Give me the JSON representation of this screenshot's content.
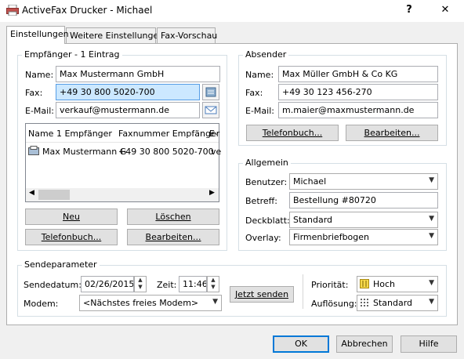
{
  "window": {
    "title": "ActiveFax Drucker - Michael",
    "help": "?",
    "close": "✕"
  },
  "tabs": [
    "Einstellungen",
    "Weitere Einstellungen",
    "Fax-Vorschau"
  ],
  "recipient": {
    "group_label": "Empfänger - 1 Eintrag",
    "name_label": "Name:",
    "name_value": "Max Mustermann GmbH",
    "fax_label": "Fax:",
    "fax_value": "+49 30 800 5020-700",
    "email_label": "E-Mail:",
    "email_value": "verkauf@mustermann.de",
    "columns": [
      "Name 1 Empfänger",
      "Faxnummer Empfänger",
      "E-"
    ],
    "rows": [
      [
        "Max Mustermann G",
        "+49 30 800 5020-700",
        "ve"
      ]
    ],
    "buttons": {
      "new": "Neu",
      "delete": "Löschen",
      "phonebook": "Telefonbuch...",
      "edit": "Bearbeiten..."
    }
  },
  "sender": {
    "group_label": "Absender",
    "name_label": "Name:",
    "name_value": "Max Müller GmbH & Co KG",
    "fax_label": "Fax:",
    "fax_value": "+49 30 123 456-270",
    "email_label": "E-Mail:",
    "email_value": "m.maier@maxmustermann.de",
    "buttons": {
      "phonebook": "Telefonbuch...",
      "edit": "Bearbeiten..."
    }
  },
  "general": {
    "group_label": "Allgemein",
    "user_label": "Benutzer:",
    "user_value": "Michael",
    "subject_label": "Betreff:",
    "subject_value": "Bestellung #80720",
    "cover_label": "Deckblatt:",
    "cover_value": "Standard",
    "overlay_label": "Overlay:",
    "overlay_value": "Firmenbriefbogen"
  },
  "send": {
    "group_label": "Sendeparameter",
    "date_label": "Sendedatum:",
    "date_value": "02/26/2015",
    "time_label": "Zeit:",
    "time_value": "11:46",
    "modem_label": "Modem:",
    "modem_value": "<Nächstes freies Modem>",
    "send_now": "Jetzt senden",
    "priority_label": "Priorität:",
    "priority_value": "Hoch",
    "resolution_label": "Auflösung:",
    "resolution_value": "Standard"
  },
  "footer": {
    "ok": "OK",
    "cancel": "Abbrechen",
    "help": "Hilfe"
  },
  "colors": {
    "accent": "#0078d7",
    "focus_fill": "#cce8ff"
  }
}
